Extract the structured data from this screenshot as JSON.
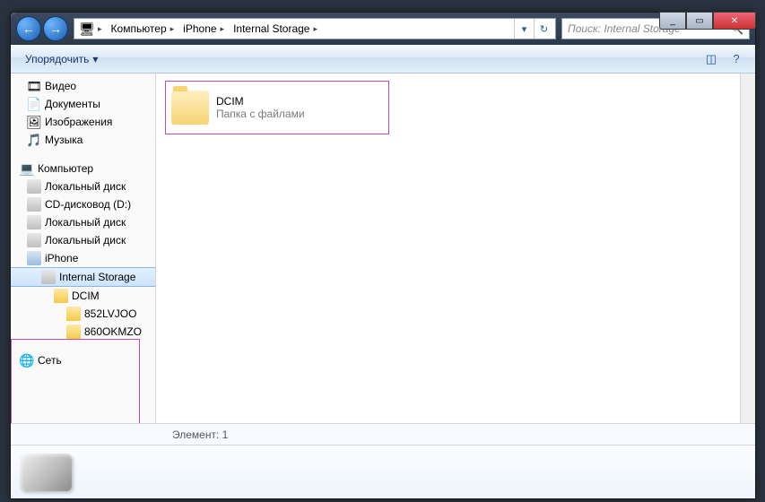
{
  "titlebar": {
    "min": "_",
    "max": "▭",
    "close": "✕"
  },
  "nav": {
    "back": "←",
    "fwd": "→"
  },
  "breadcrumb": [
    {
      "icon": "🖥",
      "label": ""
    },
    {
      "label": "Компьютер"
    },
    {
      "label": "iPhone"
    },
    {
      "label": "Internal Storage"
    }
  ],
  "address": {
    "refresh": "↻",
    "dropdown": "▾"
  },
  "search": {
    "placeholder": "Поиск: Internal Storage",
    "icon": "🔍"
  },
  "toolbar": {
    "organize": "Упорядочить",
    "organize_arrow": "▾",
    "view_icon": "◫",
    "help_icon": "?"
  },
  "sidebar": {
    "libs": [
      {
        "icon": "🎞",
        "label": "Видео"
      },
      {
        "icon": "📄",
        "label": "Документы"
      },
      {
        "icon": "🖼",
        "label": "Изображения"
      },
      {
        "icon": "🎵",
        "label": "Музыка"
      }
    ],
    "computer": {
      "icon": "💻",
      "label": "Компьютер"
    },
    "drives": [
      {
        "label": "Локальный диск"
      },
      {
        "label": "CD-дисковод (D:)"
      },
      {
        "label": "Локальный диск"
      },
      {
        "label": "Локальный диск"
      }
    ],
    "iphone": {
      "label": "iPhone"
    },
    "internal": {
      "label": "Internal Storage"
    },
    "dcim": {
      "label": "DCIM"
    },
    "sub": [
      {
        "label": "852LVJOO"
      },
      {
        "label": "860OKMZO"
      }
    ],
    "network": {
      "icon": "🌐",
      "label": "Сеть"
    }
  },
  "content": {
    "folder": {
      "name": "DCIM",
      "subtitle": "Папка с файлами"
    }
  },
  "status": {
    "text": "Элемент: 1"
  }
}
